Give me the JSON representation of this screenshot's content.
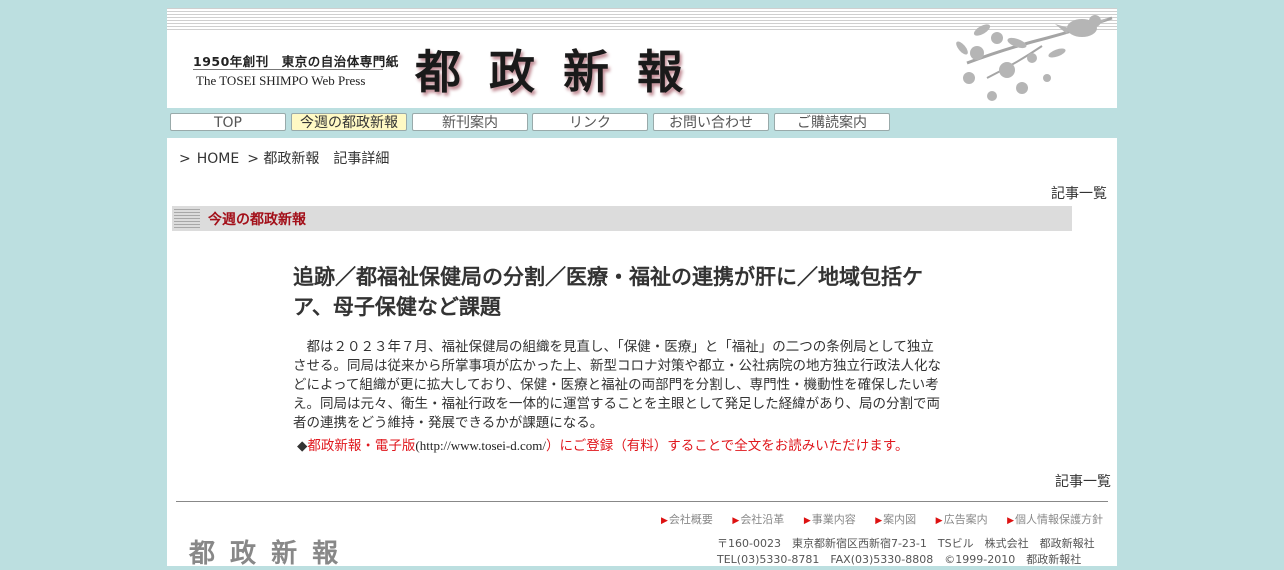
{
  "header": {
    "tagline_ja": "1950年創刊　東京の自治体専門紙",
    "tagline_en": "The TOSEI SHIMPO Web Press",
    "brand": "都 政 新 報"
  },
  "nav": {
    "items": [
      {
        "label": "TOP"
      },
      {
        "label": "今週の都政新報"
      },
      {
        "label": "新刊案内"
      },
      {
        "label": "リンク"
      },
      {
        "label": "お問い合わせ"
      },
      {
        "label": "ご購読案内"
      }
    ]
  },
  "breadcrumb": {
    "sep": ">",
    "home": "HOME",
    "current": "> 都政新報　記事詳細"
  },
  "list_link": "記事一覧",
  "section": {
    "title": "今週の都政新報"
  },
  "article": {
    "title": "追跡／都福祉保健局の分割／医療・福祉の連携が肝に／地域包括ケア、母子保健など課題",
    "body": "都は２０２３年７月、福祉保健局の組織を見直し、「保健・医療」と「福祉」の二つの条例局として独立させる。同局は従来から所掌事項が広かった上、新型コロナ対策や都立・公社病院の地方独立行政法人化などによって組織が更に拡大しており、保健・医療と福祉の両部門を分割し、専門性・機動性を確保したい考え。同局は元々、衛生・福祉行政を一体的に運営することを主眼として発足した経緯があり、局の分割で両者の連携をどう維持・発展できるかが課題になる。",
    "subscribe": {
      "bullet": "◆",
      "link_text": "都政新報・電子版",
      "url": "(http://www.tosei-d.com/",
      "rest": "）にご登録（有料）することで全文をお読みいただけます。"
    }
  },
  "footer": {
    "links": [
      "会社概要",
      "会社沿革",
      "事業内容",
      "案内図",
      "広告案内",
      "個人情報保護方針"
    ],
    "logo": "都 政 新 報",
    "address_line1": "〒160-0023　東京都新宿区西新宿7-23-1　TSビル　株式会社　都政新報社",
    "address_line2": "TEL(03)5330-8781　FAX(03)5330-8808　©1999-2010　都政新報社"
  },
  "colors": {
    "page_background": "#bcdfe0",
    "nav_active": "#fff9c4",
    "section_title": "#a3101a",
    "subscribe_red": "#e0171d"
  }
}
